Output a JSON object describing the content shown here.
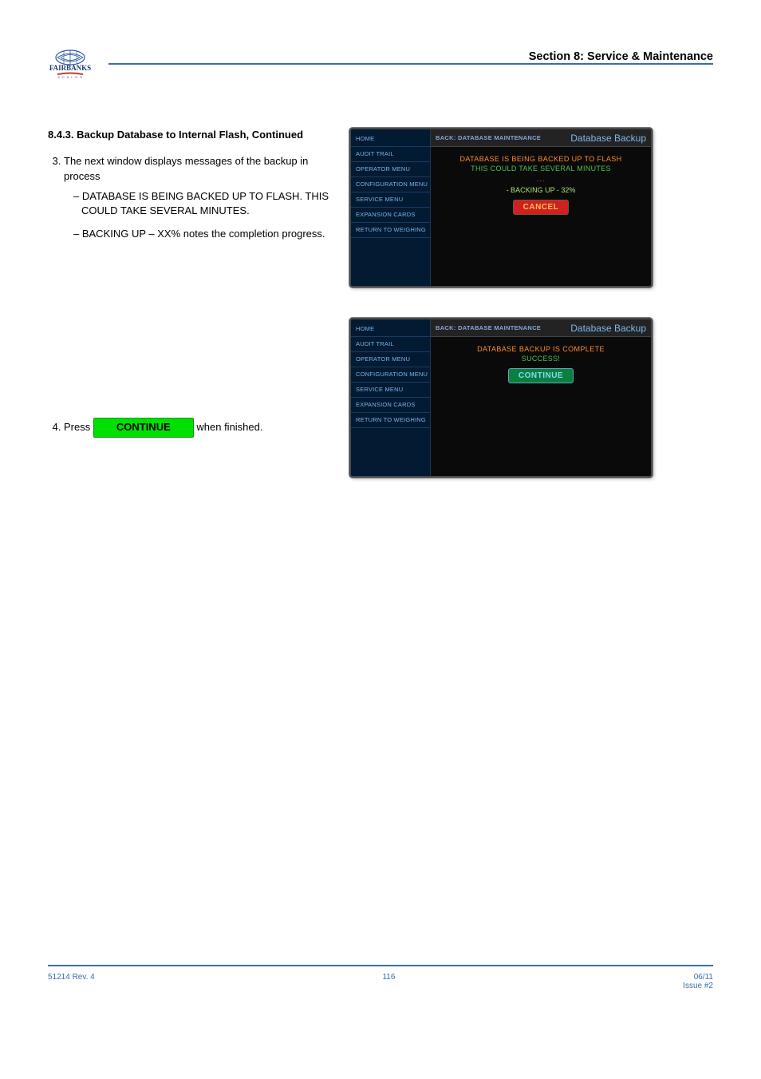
{
  "header": {
    "section_title": "Section 8:  Service & Maintenance"
  },
  "content": {
    "heading": "8.4.3. Backup Database to Internal Flash, Continued",
    "step3": "The next window displays messages of the backup in process",
    "step3_bullets": [
      "DATABASE IS BEING BACKED UP TO FLASH. THIS COULD TAKE SEVERAL MINUTES.",
      "BACKING UP – XX% notes the completion progress."
    ],
    "step4_prefix": "Press",
    "step4_button": "CONTINUE",
    "step4_suffix": "when finished."
  },
  "screenshots": {
    "sidebar_items": [
      "HOME",
      "AUDIT TRAIL",
      "OPERATOR MENU",
      "CONFIGURATION MENU",
      "SERVICE MENU",
      "EXPANSION CARDS",
      "RETURN TO WEIGHING"
    ],
    "back_label": "BACK: DATABASE MAINTENANCE",
    "title": "Database Backup",
    "progress": {
      "msg1": "DATABASE IS BEING BACKED UP TO FLASH",
      "msg2": "THIS COULD TAKE SEVERAL MINUTES",
      "dots": "···",
      "msg3": "- BACKING UP - 32%",
      "cancel": "CANCEL"
    },
    "complete": {
      "msg1": "DATABASE BACKUP IS COMPLETE",
      "msg2": "SUCCESS!",
      "continue": "CONTINUE"
    }
  },
  "footer": {
    "left_line1": "51214  Rev. 4",
    "center": "116",
    "right_line1": "06/11",
    "right_line2": "Issue #2"
  }
}
